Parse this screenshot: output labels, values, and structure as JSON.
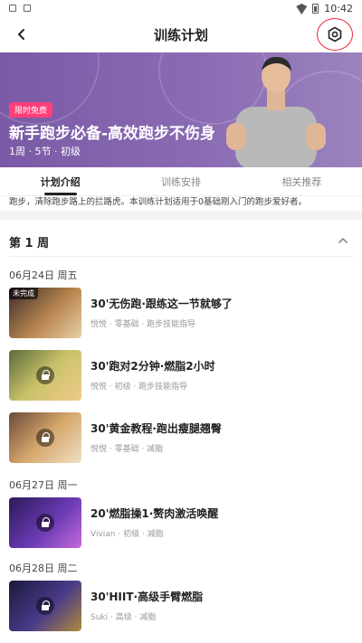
{
  "status": {
    "time": "10:42"
  },
  "header": {
    "title": "训练计划"
  },
  "hero": {
    "badge": "限时免费",
    "title": "新手跑步必备-高效跑步不伤身",
    "subtitle": "1周 · 5节 · 初级"
  },
  "tabs": [
    "计划介绍",
    "训练安排",
    "相关推荐"
  ],
  "intro_text": "跑步，清除跑步路上的拦路虎。本训练计划适用于0基础刚入门的跑步爱好者。",
  "week": {
    "label": "第 1 周"
  },
  "dates": [
    "06月24日 周五",
    "06月27日 周一",
    "06月28日 周二"
  ],
  "courses": [
    {
      "tag": "未完成",
      "title": "30'无伤跑·跟练这一节就够了",
      "meta": "悦悦 · 零基础 · 跑步技能指导"
    },
    {
      "title": "30'跑对2分钟·燃脂2小时",
      "meta": "悦悦 · 初级 · 跑步技能指导"
    },
    {
      "title": "30'黄金教程·跑出瘦腿翘臀",
      "meta": "悦悦 · 零基础 · 减脂"
    },
    {
      "title": "20'燃脂操1·赘肉激活唤醒",
      "meta": "Vivian · 初级 · 减脂"
    },
    {
      "title": "30'HIIT·高级手臂燃脂",
      "meta": "Suki · 高级 · 减脂"
    }
  ],
  "colors": {
    "hero_bg": "#8a6bb3",
    "badge": "#ff3f7a",
    "highlight_ring": "#ee2233"
  }
}
